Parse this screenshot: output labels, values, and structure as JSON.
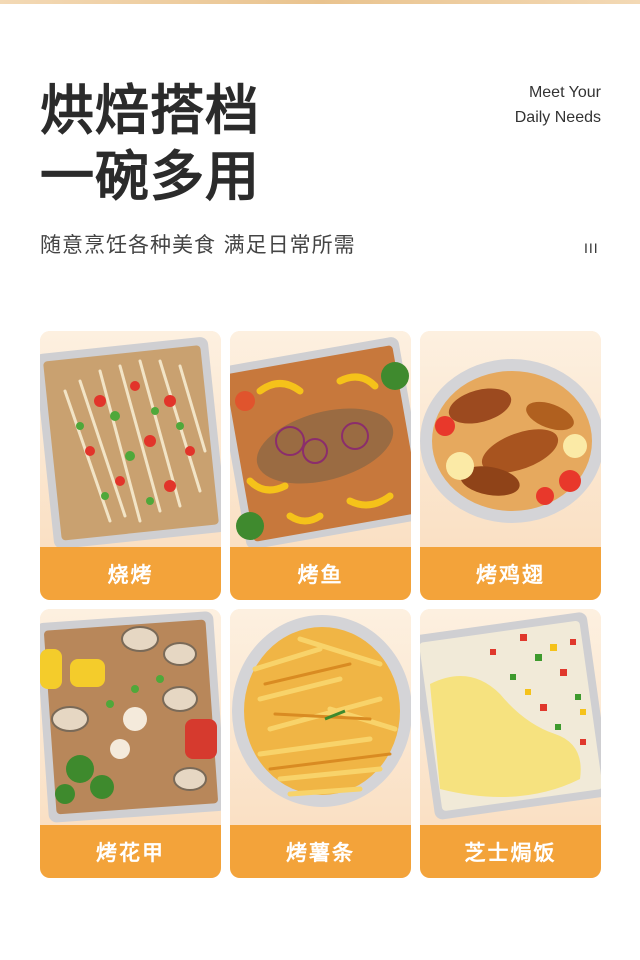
{
  "header": {
    "title_line1": "烘焙搭档",
    "title_line2": "一碗多用",
    "english_line1": "Meet Your",
    "english_line2": "Daily Needs",
    "subtitle": "随意烹饪各种美食 满足日常所需",
    "decor": "III"
  },
  "cards": [
    {
      "label": "烧烤",
      "photo": "grilled-enoki-mushroom-tray"
    },
    {
      "label": "烤鱼",
      "photo": "grilled-fish-tray"
    },
    {
      "label": "烤鸡翅",
      "photo": "roasted-chicken-wings-bowl"
    },
    {
      "label": "烤花甲",
      "photo": "grilled-clams-tray"
    },
    {
      "label": "烤薯条",
      "photo": "french-fries-bowl"
    },
    {
      "label": "芝士焗饭",
      "photo": "cheese-baked-rice-tray"
    }
  ],
  "colors": {
    "accent": "#f3a33a",
    "card_bg": "#fbe6cf",
    "title": "#2b2b2b"
  }
}
